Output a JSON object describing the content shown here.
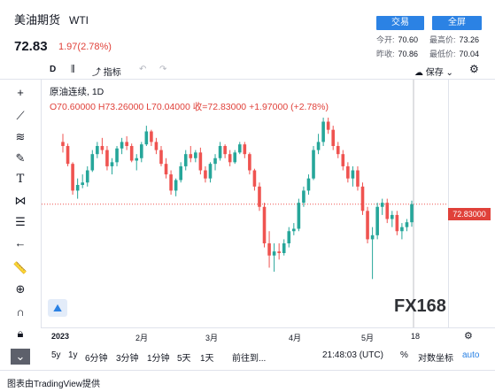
{
  "header": {
    "title": "美油期货",
    "symbol": "WTI",
    "price": "72.83",
    "change": "1.97(2.78%)",
    "btn_trade": "交易",
    "btn_fullscreen": "全屏",
    "open_label": "今开:",
    "open_value": "70.60",
    "high_label": "最高价:",
    "high_value": "73.26",
    "prev_label": "昨收:",
    "prev_value": "70.86",
    "low_label": "最低价:",
    "low_value": "70.04"
  },
  "toolbar": {
    "interval": "D",
    "indicators": "指标",
    "save": "保存"
  },
  "legend": {
    "name": "原油连续, 1D",
    "ohlc": "O70.60000  H73.26000  L70.04000  收=72.83000  +1.97000 (+2.78%)"
  },
  "price_label": "72.83000",
  "watermark": "FX168",
  "xaxis": [
    "2023",
    "2月",
    "3月",
    "4月",
    "5月",
    "18"
  ],
  "bottom_bar": {
    "ranges": [
      "5y",
      "1y",
      "6分钟",
      "3分钟",
      "1分钟",
      "5天",
      "1天"
    ],
    "goto": "前往到...",
    "time": "21:48:03 (UTC)",
    "percent": "%",
    "log": "对数坐标",
    "auto": "auto"
  },
  "footer": "图表由TradingView提供",
  "colors": {
    "up": "#26a69a",
    "down": "#ef5350",
    "accent": "#2b82e4"
  },
  "chart_data": {
    "type": "candlestick",
    "title": "原油连续, 1D",
    "candles": [
      [
        80.5,
        81.5,
        79.2,
        80.0
      ],
      [
        80.0,
        80.3,
        77.5,
        77.8
      ],
      [
        77.8,
        78.0,
        74.0,
        74.5
      ],
      [
        74.5,
        76.0,
        73.5,
        75.2
      ],
      [
        75.2,
        76.5,
        74.8,
        75.5
      ],
      [
        75.5,
        77.5,
        75.0,
        77.0
      ],
      [
        77.0,
        79.5,
        76.8,
        79.0
      ],
      [
        79.0,
        80.5,
        78.5,
        80.0
      ],
      [
        80.0,
        81.0,
        79.0,
        79.5
      ],
      [
        79.5,
        80.0,
        77.0,
        77.5
      ],
      [
        77.5,
        78.5,
        76.5,
        78.0
      ],
      [
        78.0,
        80.0,
        77.5,
        79.7
      ],
      [
        79.7,
        81.0,
        79.0,
        80.5
      ],
      [
        80.5,
        81.2,
        79.5,
        80.0
      ],
      [
        80.0,
        80.3,
        78.0,
        78.2
      ],
      [
        78.2,
        79.0,
        77.0,
        78.5
      ],
      [
        78.5,
        80.5,
        78.0,
        80.2
      ],
      [
        80.2,
        82.5,
        80.0,
        81.8
      ],
      [
        81.8,
        82.0,
        80.0,
        80.5
      ],
      [
        80.5,
        81.0,
        79.0,
        79.5
      ],
      [
        79.5,
        80.0,
        77.5,
        77.8
      ],
      [
        77.8,
        78.5,
        76.0,
        76.5
      ],
      [
        76.5,
        77.0,
        74.0,
        74.5
      ],
      [
        74.5,
        76.0,
        73.8,
        75.8
      ],
      [
        75.8,
        78.0,
        75.5,
        77.5
      ],
      [
        77.5,
        79.5,
        77.0,
        79.0
      ],
      [
        79.0,
        80.0,
        78.0,
        78.5
      ],
      [
        78.5,
        79.5,
        78.0,
        79.2
      ],
      [
        79.2,
        79.8,
        76.5,
        77.0
      ],
      [
        77.0,
        77.5,
        75.5,
        76.0
      ],
      [
        76.0,
        78.0,
        75.5,
        77.8
      ],
      [
        77.8,
        79.0,
        77.0,
        78.5
      ],
      [
        78.5,
        80.5,
        78.2,
        80.0
      ],
      [
        80.0,
        80.2,
        78.5,
        79.0
      ],
      [
        79.0,
        79.5,
        77.5,
        78.0
      ],
      [
        78.0,
        79.5,
        77.8,
        79.2
      ],
      [
        79.2,
        80.5,
        79.0,
        80.2
      ],
      [
        80.2,
        80.5,
        78.5,
        79.0
      ],
      [
        79.0,
        79.2,
        76.5,
        77.0
      ],
      [
        77.0,
        77.2,
        74.5,
        75.0
      ],
      [
        75.0,
        75.5,
        72.0,
        72.5
      ],
      [
        72.5,
        73.0,
        67.5,
        68.0
      ],
      [
        68.0,
        69.5,
        65.0,
        66.5
      ],
      [
        66.5,
        68.0,
        64.5,
        67.0
      ],
      [
        67.0,
        68.0,
        66.0,
        66.8
      ],
      [
        66.8,
        68.5,
        66.5,
        68.0
      ],
      [
        68.0,
        70.0,
        67.5,
        69.5
      ],
      [
        69.5,
        70.5,
        69.0,
        69.8
      ],
      [
        69.8,
        73.5,
        69.5,
        73.0
      ],
      [
        73.0,
        75.0,
        72.5,
        74.5
      ],
      [
        74.5,
        76.5,
        74.0,
        76.0
      ],
      [
        76.0,
        80.0,
        75.8,
        79.5
      ],
      [
        79.5,
        81.5,
        79.0,
        80.5
      ],
      [
        80.5,
        83.5,
        80.0,
        83.0
      ],
      [
        83.0,
        83.5,
        81.5,
        82.0
      ],
      [
        82.0,
        82.5,
        79.5,
        80.0
      ],
      [
        80.0,
        80.5,
        78.5,
        79.0
      ],
      [
        79.0,
        79.5,
        77.0,
        77.5
      ],
      [
        77.5,
        78.0,
        75.5,
        76.0
      ],
      [
        76.0,
        77.5,
        75.0,
        77.0
      ],
      [
        77.0,
        77.5,
        74.5,
        75.0
      ],
      [
        75.0,
        75.5,
        71.5,
        72.0
      ],
      [
        72.0,
        72.5,
        68.0,
        68.5
      ],
      [
        68.5,
        70.0,
        63.6,
        69.0
      ],
      [
        69.0,
        73.0,
        68.5,
        72.5
      ],
      [
        72.5,
        73.5,
        71.5,
        73.0
      ],
      [
        73.0,
        73.5,
        70.5,
        71.0
      ],
      [
        71.0,
        72.0,
        70.0,
        71.5
      ],
      [
        71.5,
        72.0,
        69.0,
        69.5
      ],
      [
        69.5,
        70.5,
        68.5,
        70.0
      ],
      [
        70.0,
        71.0,
        69.5,
        70.6
      ],
      [
        70.6,
        73.26,
        70.04,
        72.83
      ]
    ],
    "ylim": [
      62,
      86
    ],
    "last": 72.83
  }
}
